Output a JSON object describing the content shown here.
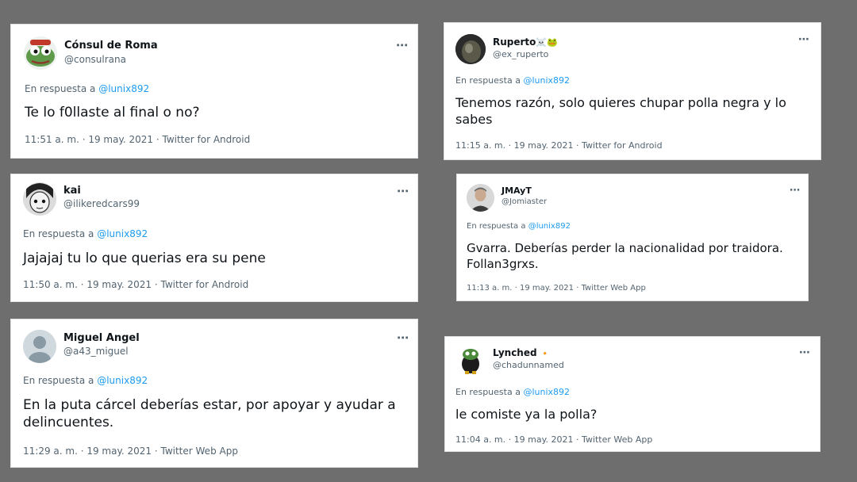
{
  "colors": {
    "background": "#6e6e6e",
    "card": "#ffffff",
    "text": "#0f1419",
    "secondary": "#536471",
    "mention": "#1d9bf0"
  },
  "more_icon": "⋯",
  "reply_prefix": "En respuesta a",
  "mention": "@lunix892",
  "tweets": [
    {
      "name": "Cónsul de Roma",
      "handle": "@consulrana",
      "text": "Te lo f0llaste al final o no?",
      "time": "11:51 a. m.",
      "date": "19 may. 2021",
      "client": "Twitter for Android",
      "avatar_icon": "pepe-frog-avatar"
    },
    {
      "name": "kai",
      "handle": "@ilikeredcars99",
      "text": "Jajajaj tu lo que querias era su pene",
      "time": "11:50 a. m.",
      "date": "19 may. 2021",
      "client": "Twitter for Android",
      "avatar_icon": "anime-character-avatar"
    },
    {
      "name": "Miguel Angel",
      "handle": "@a43_miguel",
      "text": "En la puta cárcel deberías estar, por apoyar y ayudar a delincuentes.",
      "time": "11:29 a. m.",
      "date": "19 may. 2021",
      "client": "Twitter Web App",
      "avatar_icon": "default-user-avatar"
    },
    {
      "name": "Ruperto",
      "name_emoji": "☠️🐸",
      "handle": "@ex_ruperto",
      "text": "Tenemos razón, solo quieres chupar polla negra y lo sabes",
      "time": "11:15 a. m.",
      "date": "19 may. 2021",
      "client": "Twitter for Android",
      "avatar_icon": "dark-photo-avatar"
    },
    {
      "name": "JMAyT",
      "handle": "@Jomiaster",
      "text": "Gvarra. Deberías perder la nacionalidad por traidora. Follan3grxs.",
      "time": "11:13 a. m.",
      "date": "19 may. 2021",
      "client": "Twitter Web App",
      "avatar_icon": "man-portrait-avatar"
    },
    {
      "name": "Lynched",
      "name_emoji": "🔸",
      "handle": "@chadunnamed",
      "text": "le comiste ya la polla?",
      "time": "11:04 a. m.",
      "date": "19 may. 2021",
      "client": "Twitter Web App",
      "avatar_icon": "frog-character-avatar"
    }
  ]
}
